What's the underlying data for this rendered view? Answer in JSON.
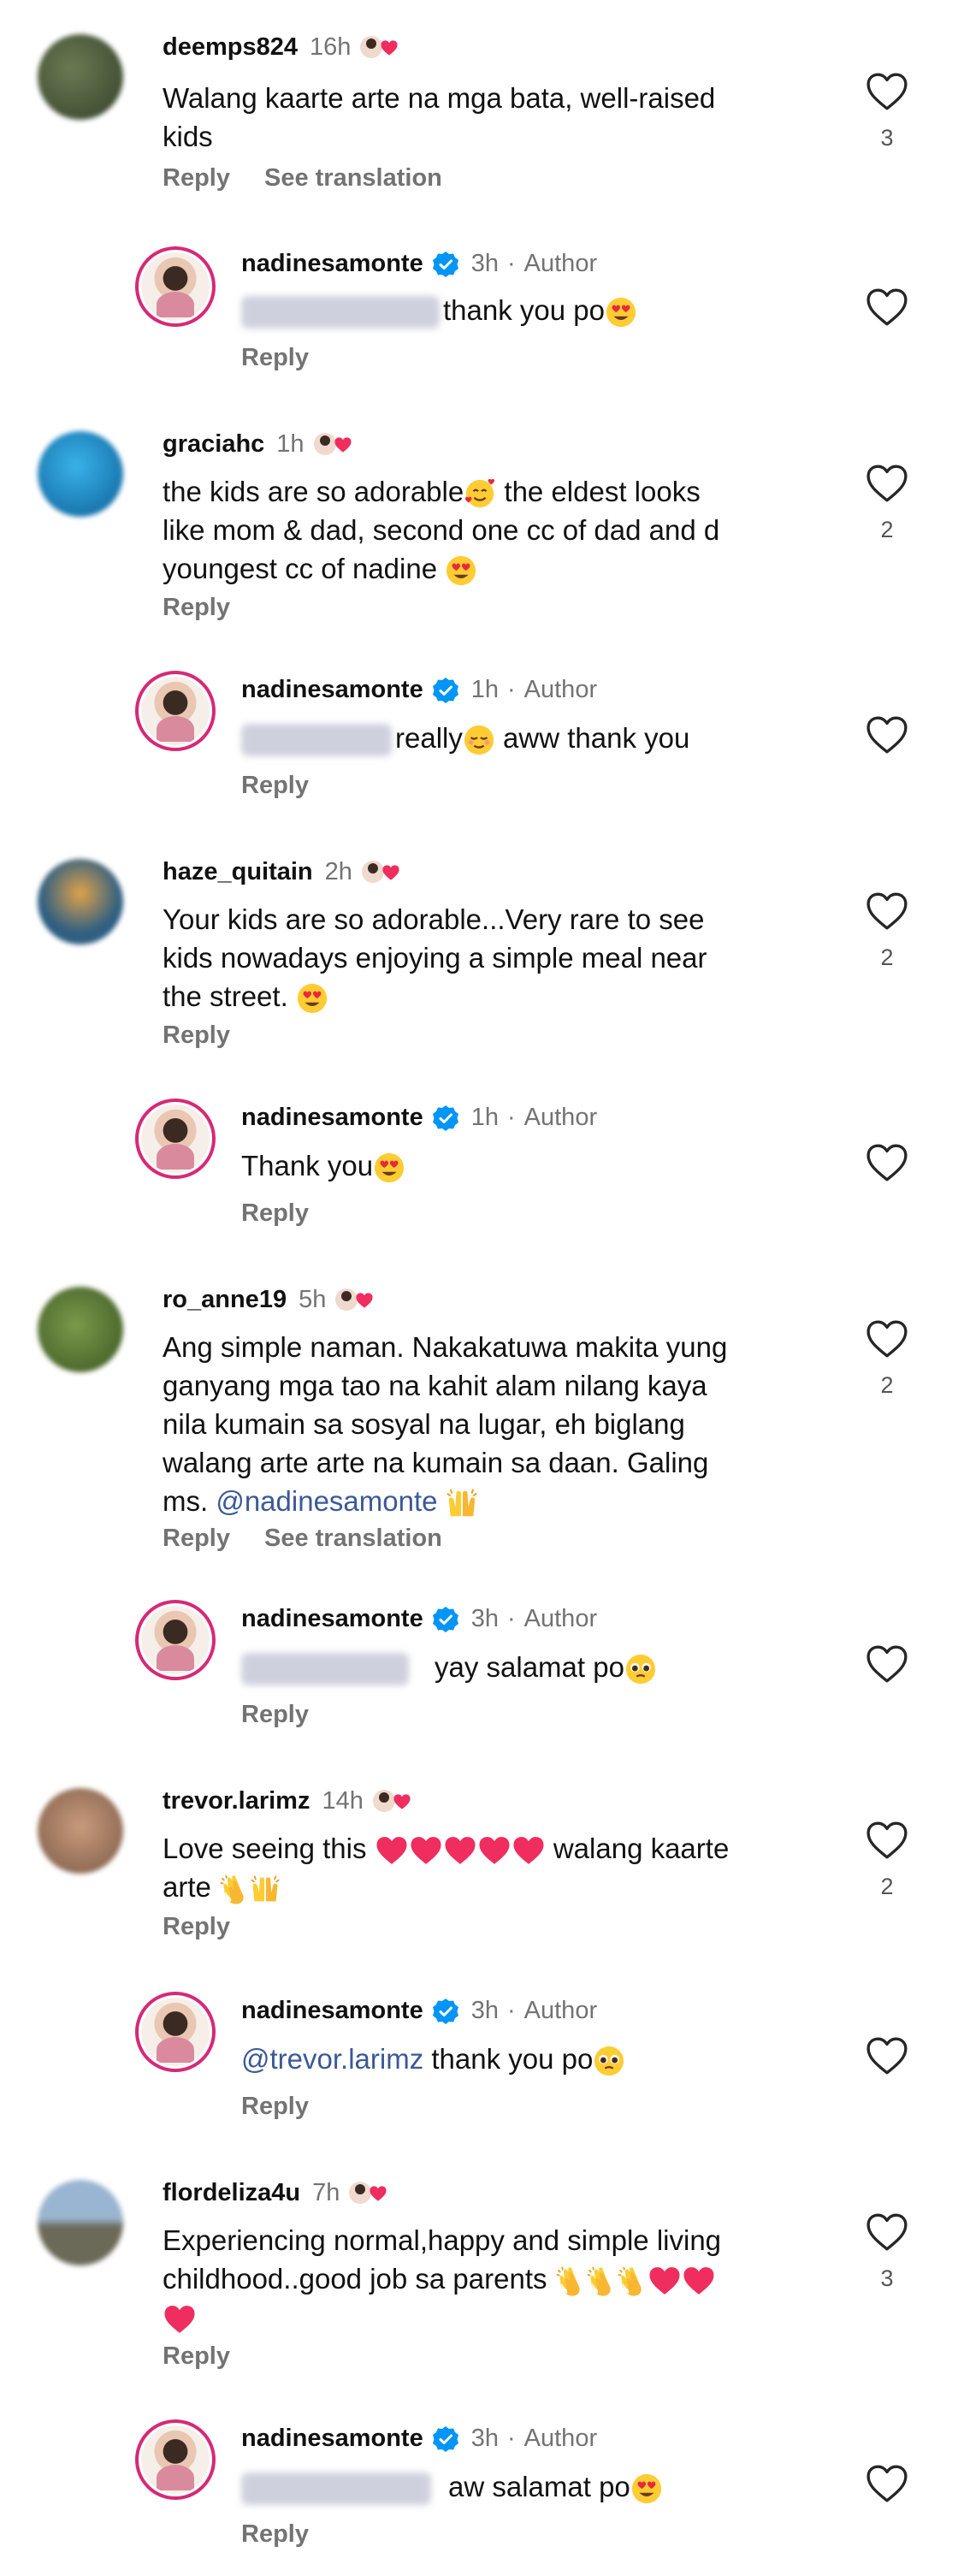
{
  "thread": [
    {
      "comment": {
        "username": "deemps824",
        "time": "16h",
        "lines": [
          "Walang kaarte arte na mga bata, well-raised",
          "kids"
        ],
        "reply": "Reply",
        "see_translation": "See translation",
        "likes": "3",
        "avatar_color": "#4d5a3a"
      },
      "response": {
        "username": "nadinesamonte",
        "time": "3h",
        "author": "Author",
        "text": "thank you po",
        "reply": "Reply"
      }
    },
    {
      "comment": {
        "username": "graciahc",
        "time": "1h",
        "lines": [
          "the kids are so adorable",
          " the eldest looks",
          "like mom & dad, second one cc of dad and  d",
          "youngest cc of nadine "
        ],
        "reply": "Reply",
        "likes": "2",
        "avatar_color": "#1f8ec9"
      },
      "response": {
        "username": "nadinesamonte",
        "time": "1h",
        "author": "Author",
        "text_a": "really",
        "text_b": " aww thank you",
        "reply": "Reply"
      }
    },
    {
      "comment": {
        "username": "haze_quitain",
        "time": "2h",
        "lines": [
          "Your kids are so adorable...Very rare to see",
          "kids nowadays enjoying a simple meal near",
          "the street. "
        ],
        "reply": "Reply",
        "likes": "2",
        "avatar_color": "#2f6c8a"
      },
      "response": {
        "username": "nadinesamonte",
        "time": "1h",
        "author": "Author",
        "text": "Thank you",
        "reply": "Reply"
      }
    },
    {
      "comment": {
        "username": "ro_anne19",
        "time": "5h",
        "lines": [
          "Ang simple naman. Nakakatuwa makita yung",
          "ganyang mga tao na kahit alam nilang kaya",
          "nila kumain sa sosyal na lugar, eh biglang",
          "walang arte arte na kumain sa daan. Galing",
          "ms. "
        ],
        "mention": "@nadinesamonte",
        "reply": "Reply",
        "see_translation": "See translation",
        "likes": "2",
        "avatar_color": "#4f6b34"
      },
      "response": {
        "username": "nadinesamonte",
        "time": "3h",
        "author": "Author",
        "text": "yay salamat po",
        "reply": "Reply"
      }
    },
    {
      "comment": {
        "username": "trevor.larimz",
        "time": "14h",
        "lines": [
          "Love seeing this ",
          " walang kaarte",
          "arte "
        ],
        "reply": "Reply",
        "likes": "2",
        "avatar_color": "#a07a62"
      },
      "response": {
        "username": "nadinesamonte",
        "time": "3h",
        "author": "Author",
        "mention": "@trevor.larimz",
        "text": " thank you po",
        "reply": "Reply"
      }
    },
    {
      "comment": {
        "username": "flordeliza4u",
        "time": "7h",
        "lines": [
          "Experiencing normal,happy and simple living",
          "childhood..good job sa parents "
        ],
        "reply": "Reply",
        "likes": "3",
        "avatar_color": "#6d88a8"
      },
      "response": {
        "username": "nadinesamonte",
        "time": "3h",
        "author": "Author",
        "text": "aw salamat po",
        "reply": "Reply"
      }
    }
  ],
  "colors": {
    "verified": "#0095f6",
    "mention": "#3b5998",
    "secondary": "#737373",
    "heart_red": "#ed1f4d"
  }
}
